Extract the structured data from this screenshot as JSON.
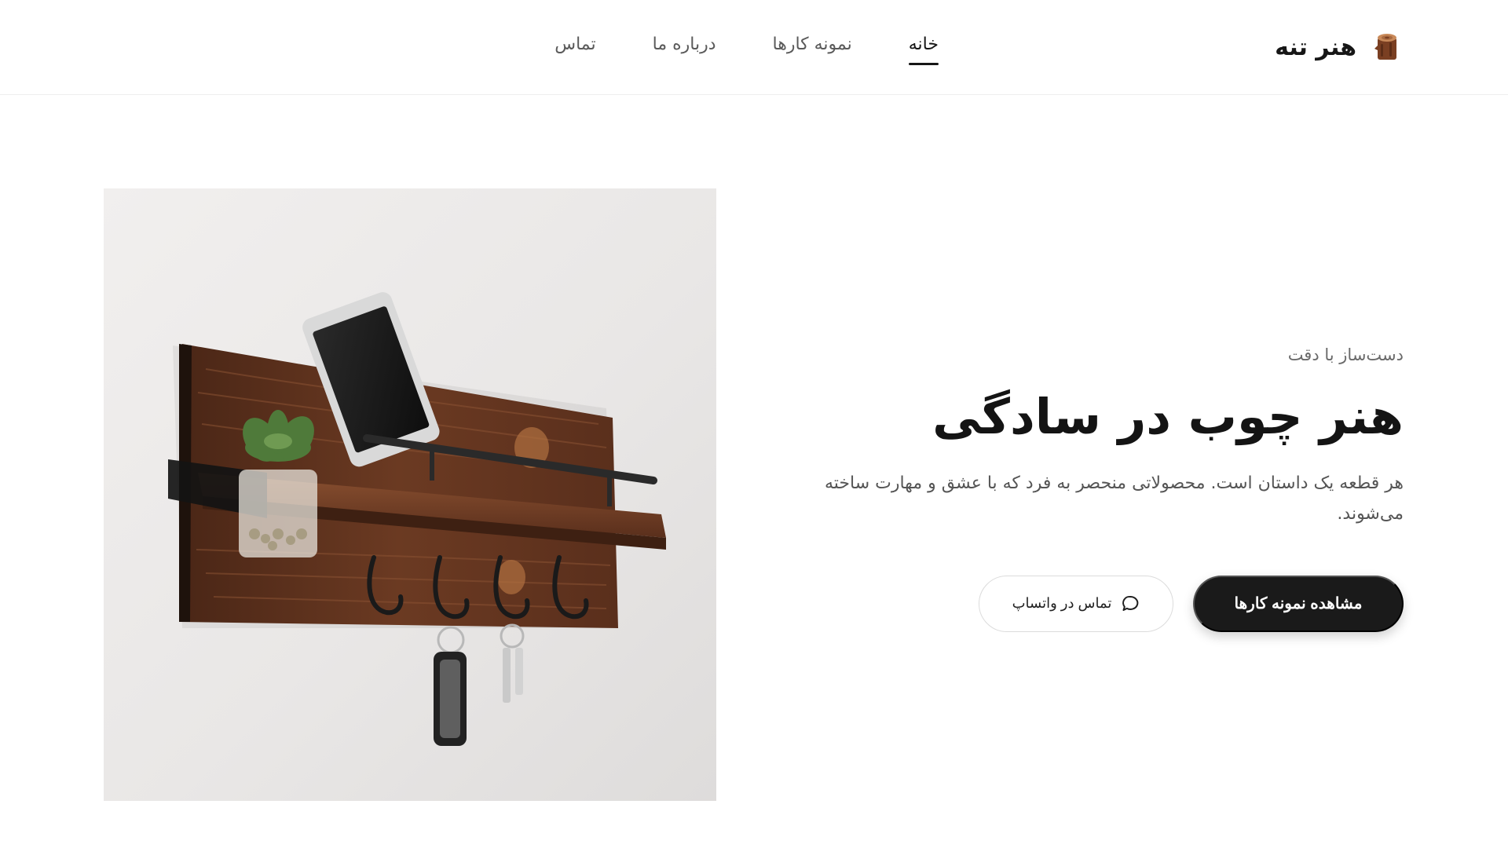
{
  "brand": {
    "name": "هنر تنه",
    "logo_icon": "wood-log-icon"
  },
  "nav": {
    "items": [
      {
        "label": "خانه",
        "active": true
      },
      {
        "label": "نمونه کارها",
        "active": false
      },
      {
        "label": "درباره ما",
        "active": false
      },
      {
        "label": "تماس",
        "active": false
      }
    ]
  },
  "hero": {
    "eyebrow": "دست‌ساز با دقت",
    "title": "هنر چوب در سادگی",
    "description": "هر قطعه یک داستان است. محصولاتی منحصر به فرد که با عشق و مهارت ساخته می‌شوند.",
    "primary_button": "مشاهده نمونه کارها",
    "secondary_button": "تماس در واتساپ",
    "secondary_icon": "chat-bubble-icon",
    "image_subject": "wooden-wall-shelf-with-key-hooks"
  },
  "colors": {
    "primary": "#1a1a1a",
    "wood": "#6b3f25",
    "background": "#ffffff"
  }
}
